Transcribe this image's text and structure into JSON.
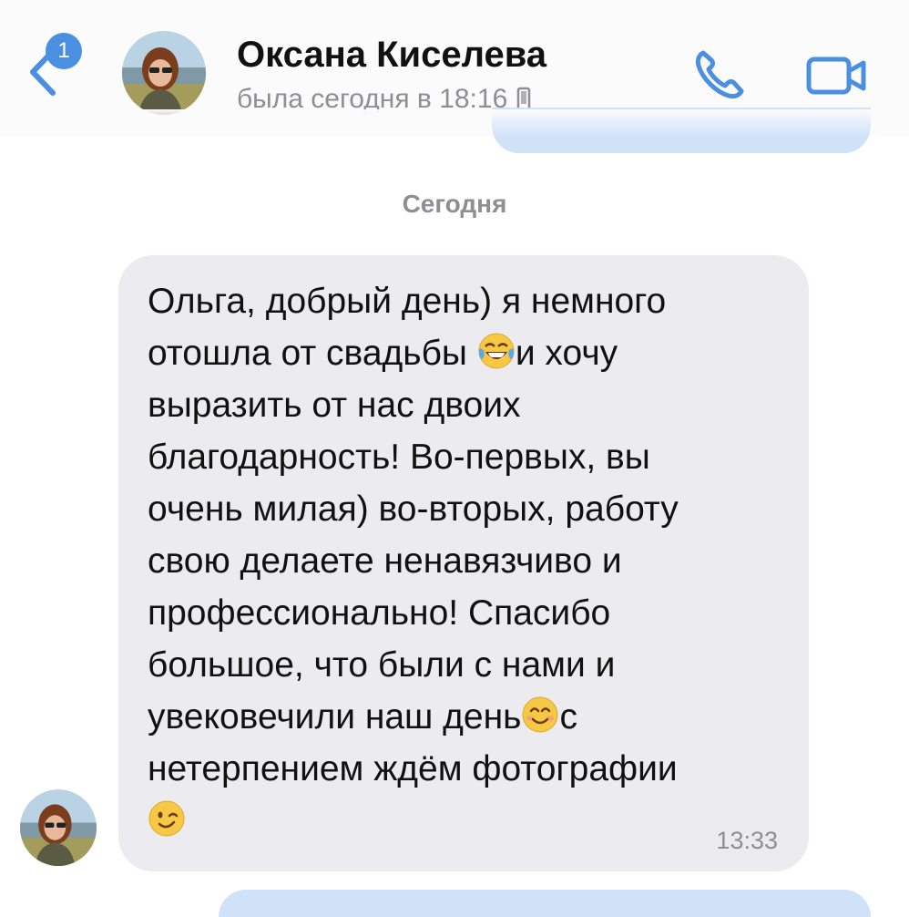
{
  "header": {
    "unread_count": "1",
    "contact_name": "Оксана Киселева",
    "status": "была сегодня в 18:16"
  },
  "chat": {
    "date_divider": "Сегодня",
    "message": {
      "lines": [
        "Ольга, добрый день) я немного",
        "отошла от свадьбы",
        "и хочу",
        "выразить от нас двоих",
        "благодарность! Во-первых, вы",
        "очень милая) во-вторых, работу",
        "свою делаете ненавязчиво и",
        "профессионально! Спасибо",
        "большое, что были с нами и",
        "увековечили наш день",
        "с",
        "нетерпением ждём фотографии"
      ],
      "time": "13:33"
    }
  },
  "colors": {
    "accent": "#4a8fe0",
    "bubble_incoming": "#ebebf0",
    "bubble_outgoing": "#cfe2f8",
    "muted_text": "#8e8e93"
  },
  "icons": {
    "back": "chevron-left-icon",
    "call": "phone-icon",
    "video": "video-camera-icon",
    "device": "mobile-device-icon",
    "emoji_1": "face-with-tears-of-joy-icon",
    "emoji_2": "smiling-face-icon",
    "emoji_3": "winking-face-icon"
  }
}
